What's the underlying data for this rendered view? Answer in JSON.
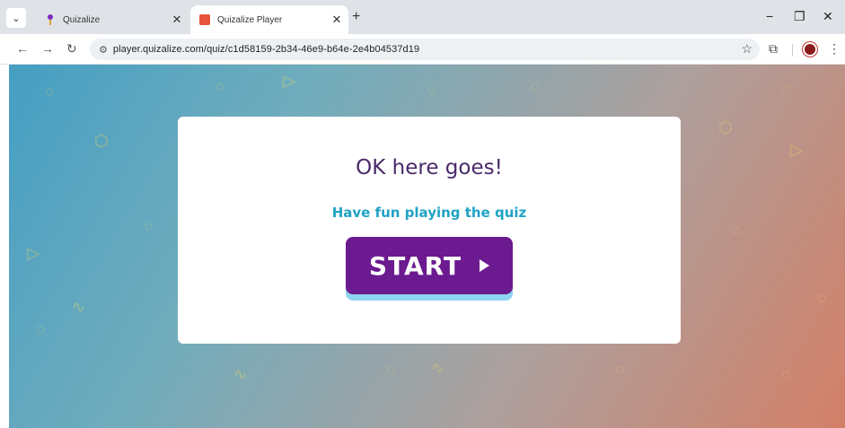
{
  "browser": {
    "tabs": [
      {
        "title": "Quizalize",
        "active": false
      },
      {
        "title": "Quizalize Player",
        "active": true
      }
    ],
    "new_tab_label": "+",
    "url": "player.quizalize.com/quiz/c1d58159-2b34-46e9-b64e-2e4b04537d19",
    "icons": {
      "tab_menu": "chevron-down-icon",
      "close": "close-icon",
      "back": "back-arrow-icon",
      "forward": "forward-arrow-icon",
      "reload": "reload-icon",
      "site_info": "tune-icon",
      "bookmark": "star-icon",
      "extensions": "puzzle-icon",
      "menu": "kebab-icon",
      "minimize": "minimize-icon",
      "restore": "restore-icon",
      "window_close": "window-close-icon"
    }
  },
  "quiz": {
    "headline": "OK here goes!",
    "subline": "Have fun playing the quiz",
    "start_label": "START",
    "colors": {
      "headline": "#4a2a6a",
      "subline": "#1fa3c4",
      "button": "#6b1a8f",
      "button_shadow": "#8fd4f0"
    }
  }
}
